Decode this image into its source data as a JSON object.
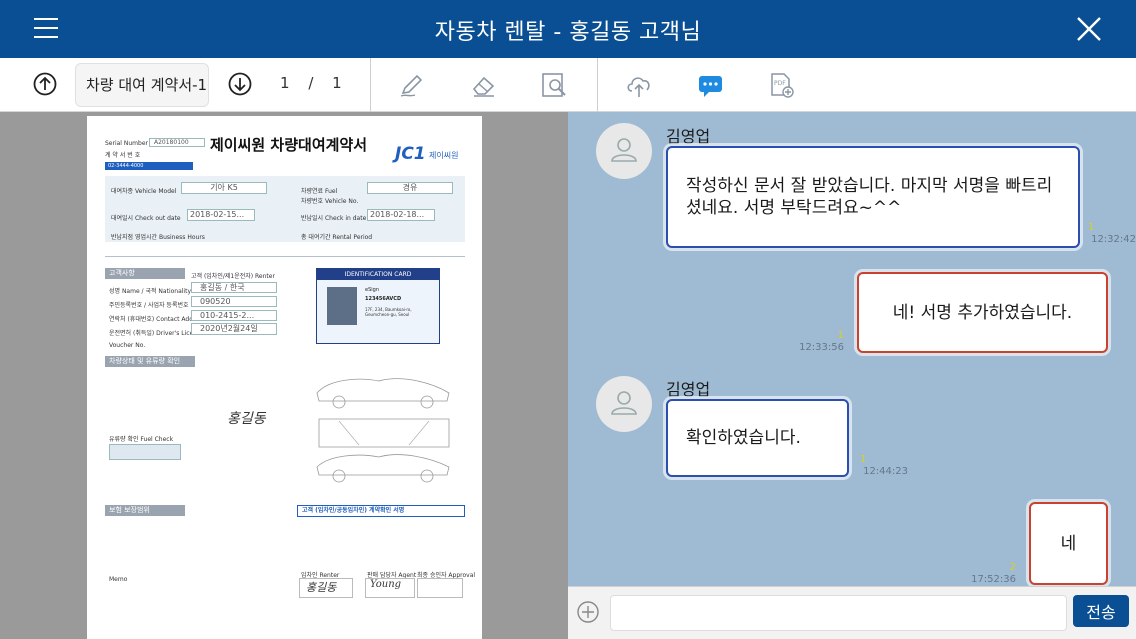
{
  "header": {
    "title": "자동차 렌탈 - 홍길동 고객님"
  },
  "toolbar": {
    "doc_name": "차량 대여 계약서-1",
    "page_current": "1",
    "page_sep": "/",
    "page_total": "1"
  },
  "contract": {
    "serial_label": "Serial Number",
    "serial_value": "A20180100",
    "serial_kr": "계 약 서 번 호",
    "title": "제이씨원 차량대여계약서",
    "brand": "제이씨원",
    "brand_logo_text": "JC1",
    "center_phone": "02-3444-4000",
    "model_label": "대여차종 Vehicle Model",
    "model_value": "기아 K5",
    "fuel_label": "차량연료 Fuel",
    "fuel_value": "경유",
    "vehicle_no_label": "차량번호 Vehicle No.",
    "checkout_label": "대여일시 Check out date",
    "checkout_value": "2018-02-15...",
    "checkin_label": "반납일시 Check in date",
    "checkin_value": "2018-02-18...",
    "hours_label": "반납지점 영업시간 Business Hours",
    "period_label": "총 대여기간 Rental Period",
    "customer_section": "고객사항",
    "renter_label": "고객 (임차인/제1운전자) Renter",
    "name_label": "성명 Name / 국적 Nationality",
    "name_value": "홍길동 / 한국",
    "id_label": "주민등록번호 / 사업자 등록번호",
    "id_value": "090520",
    "phone_label": "연락처 (휴대번호) Contact Address",
    "phone_value": "010-2415-2...",
    "license_label": "운전면허 (취득일) Driver's License",
    "license_value": "2020년2월24일",
    "voucher_label": "Voucher No.",
    "id_card_title": "IDENTIFICATION CARD",
    "id_card_name": "eSign",
    "id_card_no": "123456AVCD",
    "id_card_addr": "17F, 234, Baumkoai-ro, Geumcheon-gu, Seoul",
    "vehicle_section": "차량상태 및 유류량 확인",
    "fuel_check_label": "유류량 확인 Fuel Check",
    "signature_name": "홍길동",
    "insurance_section": "보험 보장범위",
    "confirm_section": "고객 (임차인/공동임차인) 계약확인 서명",
    "renter_sig_label": "임차인 Renter",
    "agent_sig_label": "판매 담당자 Agent",
    "approval_label": "최종 승인자 Approval",
    "agent_signature": "Young",
    "memo_label": "Memo"
  },
  "chat": {
    "messages": [
      {
        "sender": "김영업",
        "direction": "in",
        "text": "작성하신 문서 잘 받았습니다. 마지막 서명을 빠트리셨네요. 서명 부탁드려요~^^",
        "read": "1",
        "time": "12:32:42"
      },
      {
        "direction": "out",
        "text": "네! 서명 추가하였습니다.",
        "read": "1",
        "time": "12:33:56"
      },
      {
        "sender": "김영업",
        "direction": "in",
        "text": "확인하였습니다.",
        "read": "1",
        "time": "12:44:23"
      },
      {
        "direction": "out",
        "text": "네",
        "read": "2",
        "time": "17:52:36"
      }
    ]
  },
  "input": {
    "placeholder": "",
    "send_label": "전송"
  },
  "colors": {
    "header": "#0a4f93",
    "chat_bg": "#9fbad3",
    "in_border": "#2a4fb0",
    "out_border": "#c8422e"
  }
}
